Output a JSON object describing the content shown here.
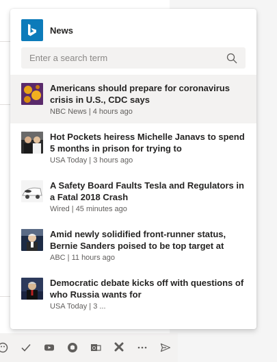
{
  "popup": {
    "title": "News",
    "search": {
      "placeholder": "Enter a search term"
    }
  },
  "news": [
    {
      "title": "Americans should prepare for coronavirus crisis in U.S., CDC says",
      "meta": "NBC News | 4 hours ago",
      "thumb": "coronavirus-thumb",
      "selected": true
    },
    {
      "title": "Hot Pockets heiress Michelle Janavs to spend 5 months in prison for trying to",
      "meta": "USA Today | 3 hours ago",
      "thumb": "courtroom-thumb"
    },
    {
      "title": "A Safety Board Faults Tesla and Regulators in a Fatal 2018 Crash",
      "meta": "Wired | 45 minutes ago",
      "thumb": "tesla-thumb"
    },
    {
      "title": "Amid newly solidified front-runner status, Bernie Sanders poised to be top target at",
      "meta": "ABC | 11 hours ago",
      "thumb": "sanders-thumb"
    },
    {
      "title": "Democratic debate kicks off with questions of who Russia wants for",
      "meta": "USA Today | 3 ...",
      "thumb": "debate-thumb"
    }
  ],
  "toolbar": {
    "icons": [
      "emoji-icon",
      "check-icon",
      "youtube-icon",
      "github-icon",
      "outlook-icon",
      "sharepoint-icon",
      "more-options-icon",
      "send-icon"
    ]
  },
  "colors": {
    "bing_brand": "#0c7bba",
    "selected_bg": "#f3f2f1"
  }
}
